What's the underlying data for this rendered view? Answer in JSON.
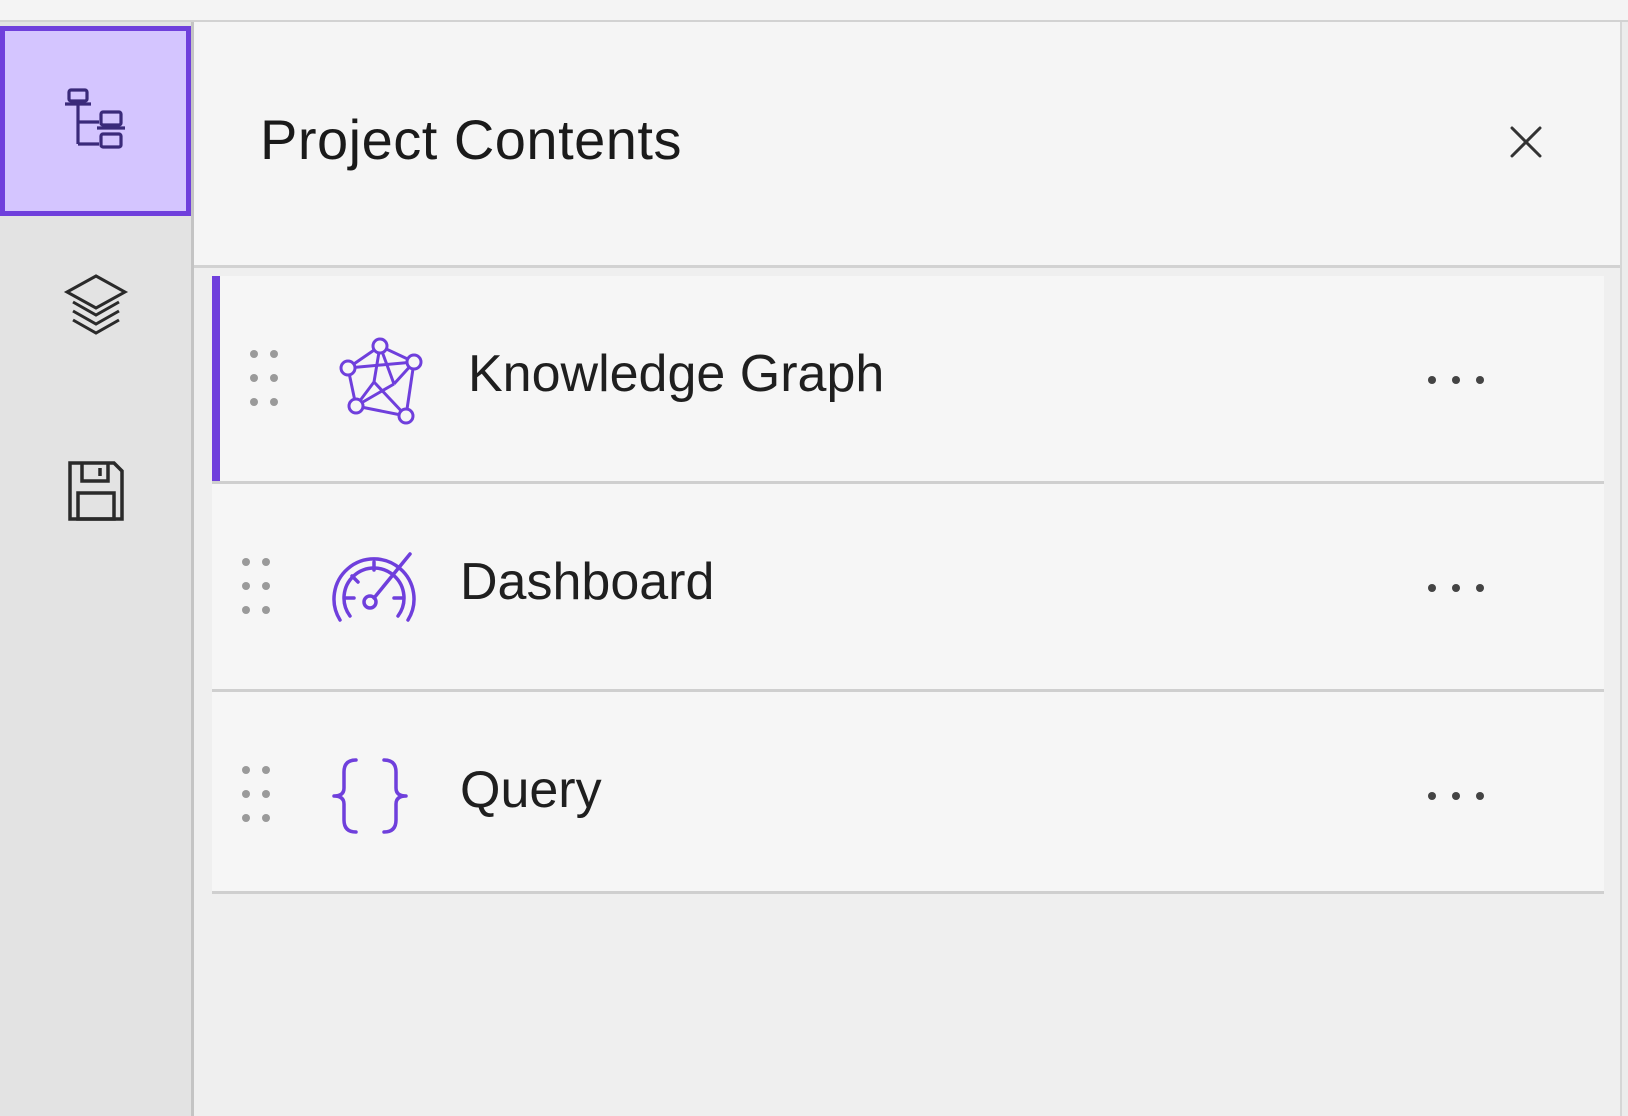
{
  "header": {
    "title": "Project Contents",
    "close_icon": "close-icon"
  },
  "action_bar": {
    "items": [
      {
        "name": "project-contents",
        "icon": "hierarchy-icon",
        "active": true
      },
      {
        "name": "layers",
        "icon": "layers-icon",
        "active": false
      },
      {
        "name": "save",
        "icon": "save-icon",
        "active": false
      }
    ]
  },
  "contents": {
    "items": [
      {
        "label": "Knowledge Graph",
        "icon": "knowledge-graph-icon",
        "selected": true
      },
      {
        "label": "Dashboard",
        "icon": "dashboard-gauge-icon",
        "selected": false
      },
      {
        "label": "Query",
        "icon": "curly-braces-icon",
        "selected": false
      }
    ]
  },
  "colors": {
    "accent": "#6f3fdc",
    "active_background": "#d4c5ff",
    "panel_background": "#f5f5f5",
    "action_bar_background": "#e3e3e3",
    "text": "#1a1a1a"
  }
}
